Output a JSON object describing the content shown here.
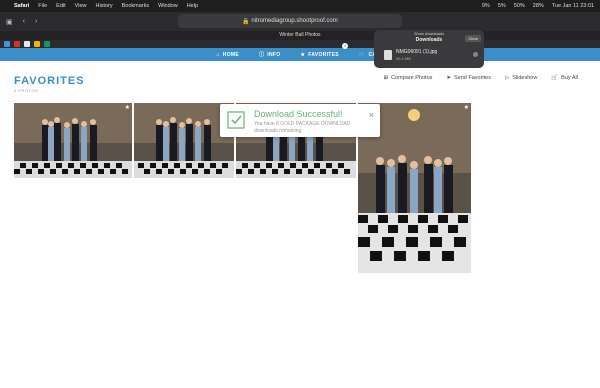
{
  "menubar": {
    "app": "Safari",
    "items": [
      "File",
      "Edit",
      "View",
      "History",
      "Bookmarks",
      "Window",
      "Help"
    ],
    "clock": "Tue Jan 11 23:01",
    "battery": "50%",
    "wifi_pct": "5%",
    "cpu": "9%",
    "mem": "28%"
  },
  "browser": {
    "url": "nitromediagroup.shootproof.com",
    "tab_title": "Winter Ball Photos"
  },
  "site_nav": {
    "items": [
      "HOME",
      "INFO",
      "FAVORITES",
      "CART"
    ],
    "favorites_count": "4"
  },
  "page": {
    "title": "FAVORITES",
    "count": "4 PHOTOS",
    "actions": [
      "Compare Photos",
      "Send Favorites",
      "Slideshow",
      "Buy All"
    ]
  },
  "toast": {
    "title": "Download Successful!",
    "message": "You have 8 GOLD PACKAGE DOWNLOAD downloads remaining."
  },
  "downloads": {
    "hint": "Show downloads",
    "header": "Downloads",
    "clear": "Clear",
    "filename": "NMG06091 (1).jpg",
    "size": "35.4 MB"
  },
  "colors": {
    "brand": "#3c8ec9",
    "success": "#6ab27a"
  }
}
